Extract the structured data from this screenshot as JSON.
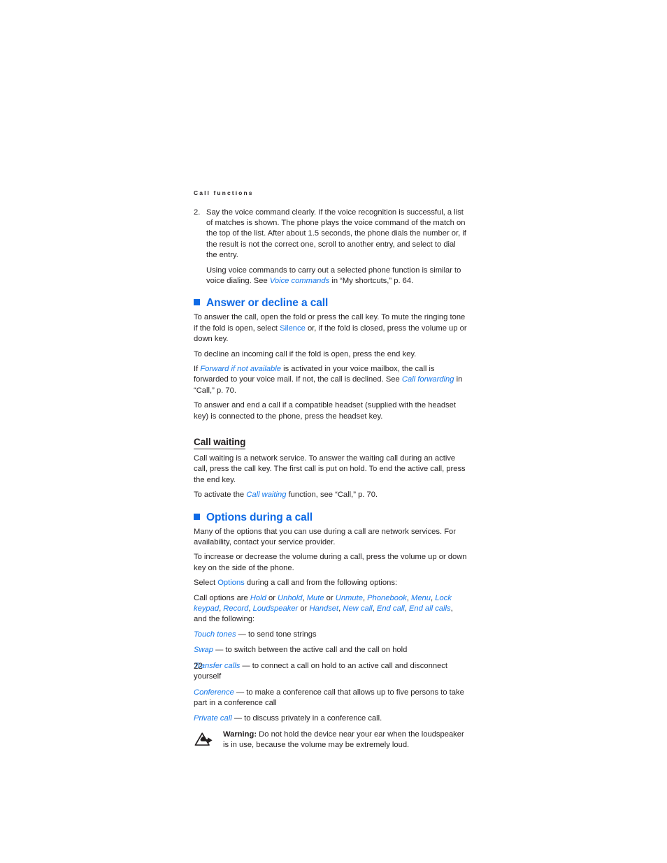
{
  "page": {
    "running_head": "Call functions",
    "folio": "22",
    "accent_color": "#0f6ae5",
    "link_color": "#1577e8",
    "text_color": "#231f20"
  },
  "step": {
    "number": "2.",
    "para1": "Say the voice command clearly. If the voice recognition is successful, a list of matches is shown. The phone plays the voice command of the match on the top of the list. After about 1.5 seconds, the phone dials the number or, if the result is not the correct one, scroll to another entry, and select to dial the entry.",
    "para2_pre": "Using voice commands to carry out a selected phone function is similar to voice dialing. See ",
    "para2_link": "Voice commands",
    "para2_post": " in “My shortcuts,” p. 64."
  },
  "answer_section": {
    "bullet_icon": "blue-square-bullet",
    "heading": "Answer or decline a call",
    "p1_a": "To answer the call, open the fold or press the call key. To mute the ringing tone if the fold is open, select ",
    "p1_link": "Silence",
    "p1_b": " or, if the fold is closed, press the volume up or down key.",
    "p2": "To decline an incoming call if the fold is open, press the end key.",
    "p3_a": "If ",
    "p3_link1": "Forward if not available",
    "p3_b": " is activated in your voice mailbox, the call is forwarded to your voice mail. If not, the call is declined. See ",
    "p3_link2": "Call forwarding",
    "p3_c": " in “Call,” p. 70.",
    "p4": "To answer and end a call if a compatible headset (supplied with the headset key) is connected to the phone, press the headset key."
  },
  "call_waiting": {
    "heading": "Call waiting",
    "p1": "Call waiting is a network service. To answer the waiting call during an active call, press the call key. The first call is put on hold. To end the active call, press the end key.",
    "p2_a": "To activate the ",
    "p2_link": "Call waiting",
    "p2_b": " function, see “Call,” p. 70."
  },
  "options_section": {
    "bullet_icon": "blue-square-bullet",
    "heading": "Options during a call",
    "p1": "Many of the options that you can use during a call are network services. For availability, contact your service provider.",
    "p2": "To increase or decrease the volume during a call, press the volume up or down key on the side of the phone.",
    "p3_a": "Select ",
    "p3_link": "Options",
    "p3_b": " during a call and from the following options:",
    "call_options": {
      "lead": "Call options are ",
      "o1": "Hold",
      "s1": " or ",
      "o2": "Unhold",
      "s2": ", ",
      "o3": "Mute",
      "s3": " or ",
      "o4": "Unmute",
      "s4": ", ",
      "o5": "Phonebook",
      "s5": ", ",
      "o6": "Menu",
      "s6": ", ",
      "o7": "Lock keypad",
      "s7": ", ",
      "o8": "Record",
      "s8": ", ",
      "o9": "Loudspeaker",
      "s9": " or ",
      "o10": "Handset",
      "s10": ", ",
      "o11": "New call",
      "s11": ", ",
      "o12": "End call",
      "s12": ", ",
      "o13": "End all calls",
      "tail": ", and the following:"
    },
    "items": [
      {
        "term": "Touch tones",
        "desc": " — to send tone strings"
      },
      {
        "term": "Swap",
        "desc": " — to switch between the active call and the call on hold"
      },
      {
        "term": "Transfer calls",
        "desc": " — to connect a call on hold to an active call and disconnect yourself"
      },
      {
        "term": "Conference",
        "desc": " — to make a conference call that allows up to five persons to take part in a conference call"
      },
      {
        "term": "Private call",
        "desc": " — to discuss privately in a conference call."
      }
    ]
  },
  "warning": {
    "icon": "warning-triangle-hand-icon",
    "label": "Warning:",
    "text": " Do not hold the device near your ear when the loudspeaker is in use, because the volume may be extremely loud."
  }
}
